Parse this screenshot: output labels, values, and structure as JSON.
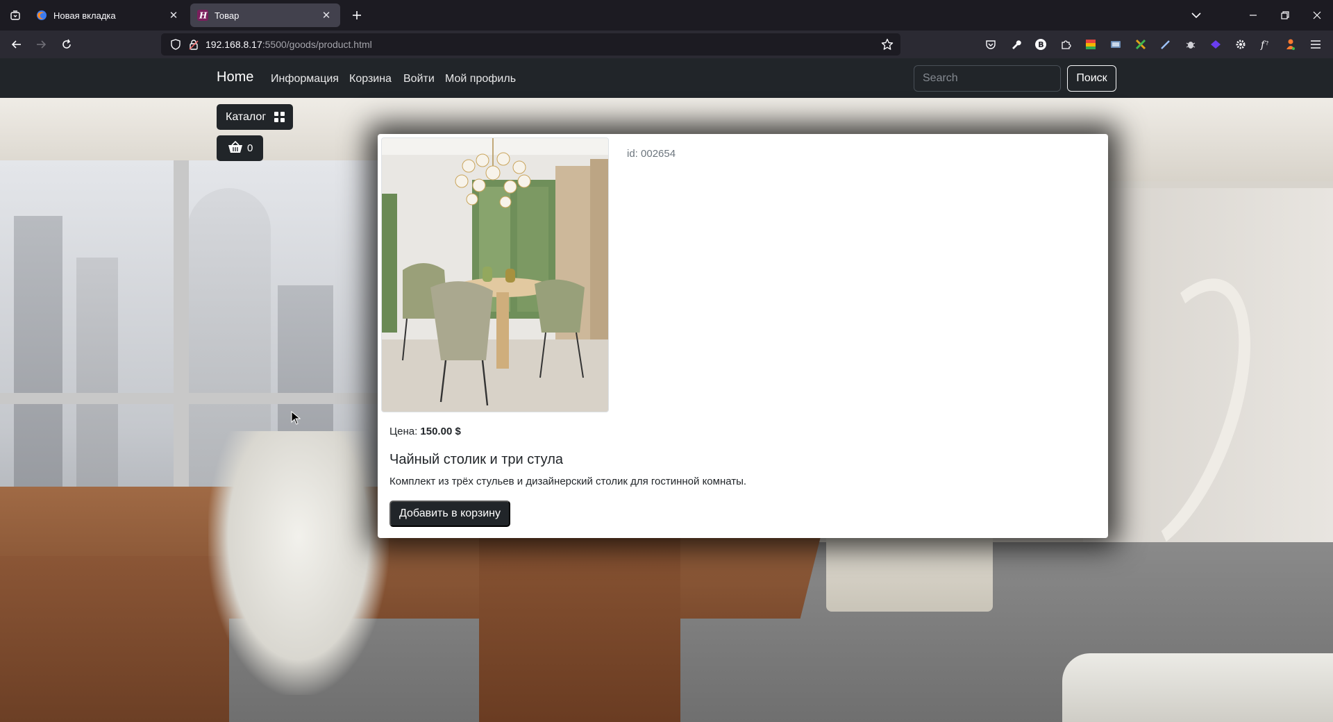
{
  "browser": {
    "tabs": [
      {
        "title": "Новая вкладка",
        "active": false
      },
      {
        "title": "Товар",
        "active": true
      }
    ],
    "url": {
      "host": "192.168.8.17",
      "path": ":5500/goods/product.html"
    }
  },
  "site_nav": {
    "brand": "Home",
    "links": [
      "Информация",
      "Корзина",
      "Войти",
      "Мой профиль"
    ],
    "search_placeholder": "Search",
    "search_button": "Поиск"
  },
  "catalog": {
    "label": "Каталог"
  },
  "cart": {
    "count": "0"
  },
  "product": {
    "id_text": "id: 002654",
    "price_label": "Цена:",
    "price_value": "150.00 $",
    "title": "Чайный столик и три стула",
    "description": "Комплект из трёх стульев и дизайнерский столик для гостинной комнаты.",
    "add_button": "Добавить в корзину"
  },
  "colors": {
    "navbar_bg": "#212529",
    "browser_bg": "#1c1b22",
    "toolbar_bg": "#2b2a33"
  }
}
